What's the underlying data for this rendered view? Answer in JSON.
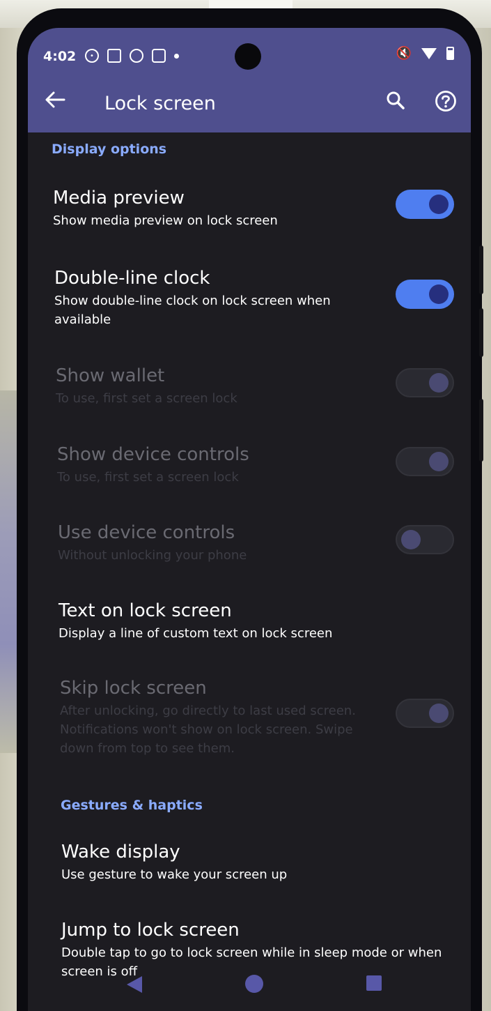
{
  "status_bar": {
    "time": "4:02"
  },
  "app_bar": {
    "title": "Lock screen"
  },
  "sections": {
    "display_options": "Display options",
    "gestures_haptics": "Gestures & haptics"
  },
  "items": [
    {
      "title": "Media preview",
      "subtitle": "Show media preview on lock screen",
      "toggle": "on",
      "enabled": true
    },
    {
      "title": "Double-line clock",
      "subtitle": "Show double-line clock on lock screen when available",
      "toggle": "on",
      "enabled": true
    },
    {
      "title": "Show wallet",
      "subtitle": "To use, first set a screen lock",
      "toggle": "on",
      "enabled": false
    },
    {
      "title": "Show device controls",
      "subtitle": "To use, first set a screen lock",
      "toggle": "on",
      "enabled": false
    },
    {
      "title": "Use device controls",
      "subtitle": "Without unlocking your phone",
      "toggle": "off",
      "enabled": false
    },
    {
      "title": "Text on lock screen",
      "subtitle": "Display a line of custom text on lock screen",
      "enabled": true
    },
    {
      "title": "Skip lock screen",
      "subtitle": "After unlocking, go directly to last used screen. Notifications won't show on lock screen. Swipe down from top to see them.",
      "toggle": "on",
      "enabled": false
    },
    {
      "title": "Wake display",
      "subtitle": "Use gesture to wake your screen up",
      "enabled": true
    },
    {
      "title": "Jump to lock screen",
      "subtitle": "Double tap to go to lock screen while in sleep mode or when screen is off",
      "enabled": true
    }
  ],
  "colors": {
    "app_bar": "#4f4f8e",
    "background": "#1d1c21",
    "accent": "#4f7ef0",
    "section_header": "#8aabff"
  }
}
